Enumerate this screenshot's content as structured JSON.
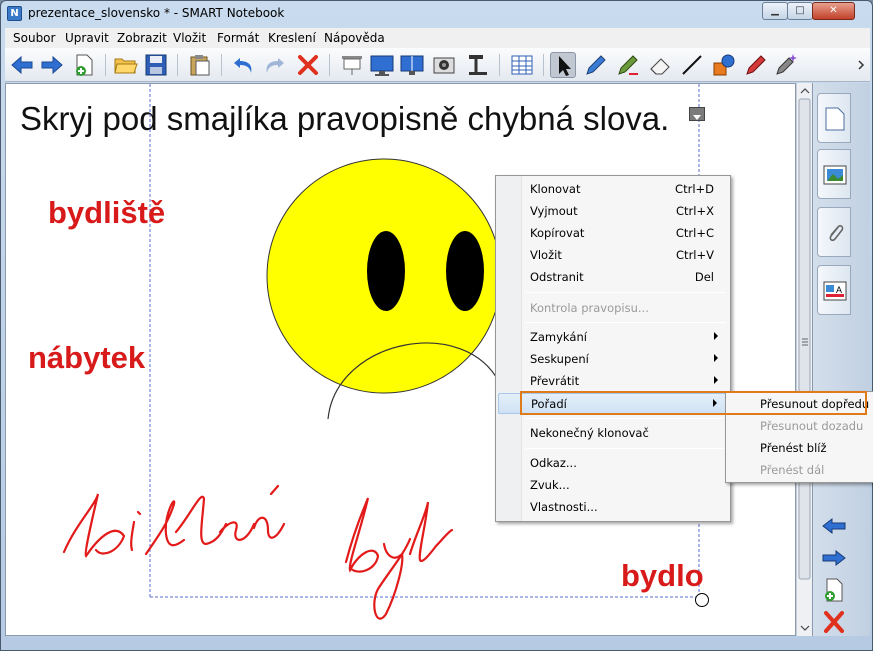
{
  "window": {
    "title": "prezentace_slovensko * - SMART Notebook",
    "app_icon": "notebook-icon",
    "controls": {
      "minimize": "▁",
      "maximize": "□",
      "close": "✕"
    }
  },
  "menubar": [
    "Soubor",
    "Upravit",
    "Zobrazit",
    "Vložit",
    "Formát",
    "Kreslení",
    "Nápověda"
  ],
  "toolbar": {
    "icons": [
      "back-arrow-icon",
      "forward-arrow-icon",
      "add-page-icon",
      "open-folder-icon",
      "save-icon",
      "paste-icon",
      "undo-icon",
      "redo-icon",
      "delete-icon",
      "screen-shade-icon",
      "full-screen-icon",
      "dual-page-icon",
      "capture-icon",
      "document-camera-icon",
      "table-icon",
      "select-pointer-icon",
      "pen-icon",
      "creative-pen-icon",
      "eraser-icon",
      "line-icon",
      "shapes-icon",
      "magic-pen-icon",
      "shape-recognition-pen-icon",
      "more-icon"
    ]
  },
  "canvas": {
    "heading": "Skryj pod smajlíka pravopisně chybná slova.",
    "red_words": [
      "bydliště",
      "nábytek",
      "bydlo"
    ],
    "handwriting": [
      "bidlení",
      "byl"
    ]
  },
  "context_menu": {
    "items": [
      {
        "label": "Klonovat",
        "shortcut": "Ctrl+D"
      },
      {
        "label": "Vyjmout",
        "shortcut": "Ctrl+X"
      },
      {
        "label": "Kopírovat",
        "shortcut": "Ctrl+C"
      },
      {
        "label": "Vložit",
        "shortcut": "Ctrl+V"
      },
      {
        "label": "Odstranit",
        "shortcut": "Del"
      },
      {
        "label": "Kontrola pravopisu..."
      },
      {
        "label": "Zamykání"
      },
      {
        "label": "Seskupení"
      },
      {
        "label": "Převrátit"
      },
      {
        "label": "Pořadí"
      },
      {
        "label": "Nekonečný klonovač"
      },
      {
        "label": "Odkaz..."
      },
      {
        "label": "Zvuk..."
      },
      {
        "label": "Vlastnosti..."
      }
    ]
  },
  "submenu": {
    "items": [
      {
        "label": "Přesunout dopředu"
      },
      {
        "label": "Přesunout dozadu"
      },
      {
        "label": "Přenést blíž"
      },
      {
        "label": "Přenést dál"
      }
    ]
  },
  "sidebar": {
    "tabs": [
      "page-sorter-icon",
      "gallery-icon",
      "attachments-icon",
      "properties-icon"
    ],
    "buttons": [
      "previous-page-icon",
      "next-page-icon",
      "add-page-icon",
      "delete-page-icon"
    ]
  },
  "colors": {
    "accent": "#e07b1a",
    "red_text": "#d81a1a",
    "smiley": "#ffff00"
  }
}
